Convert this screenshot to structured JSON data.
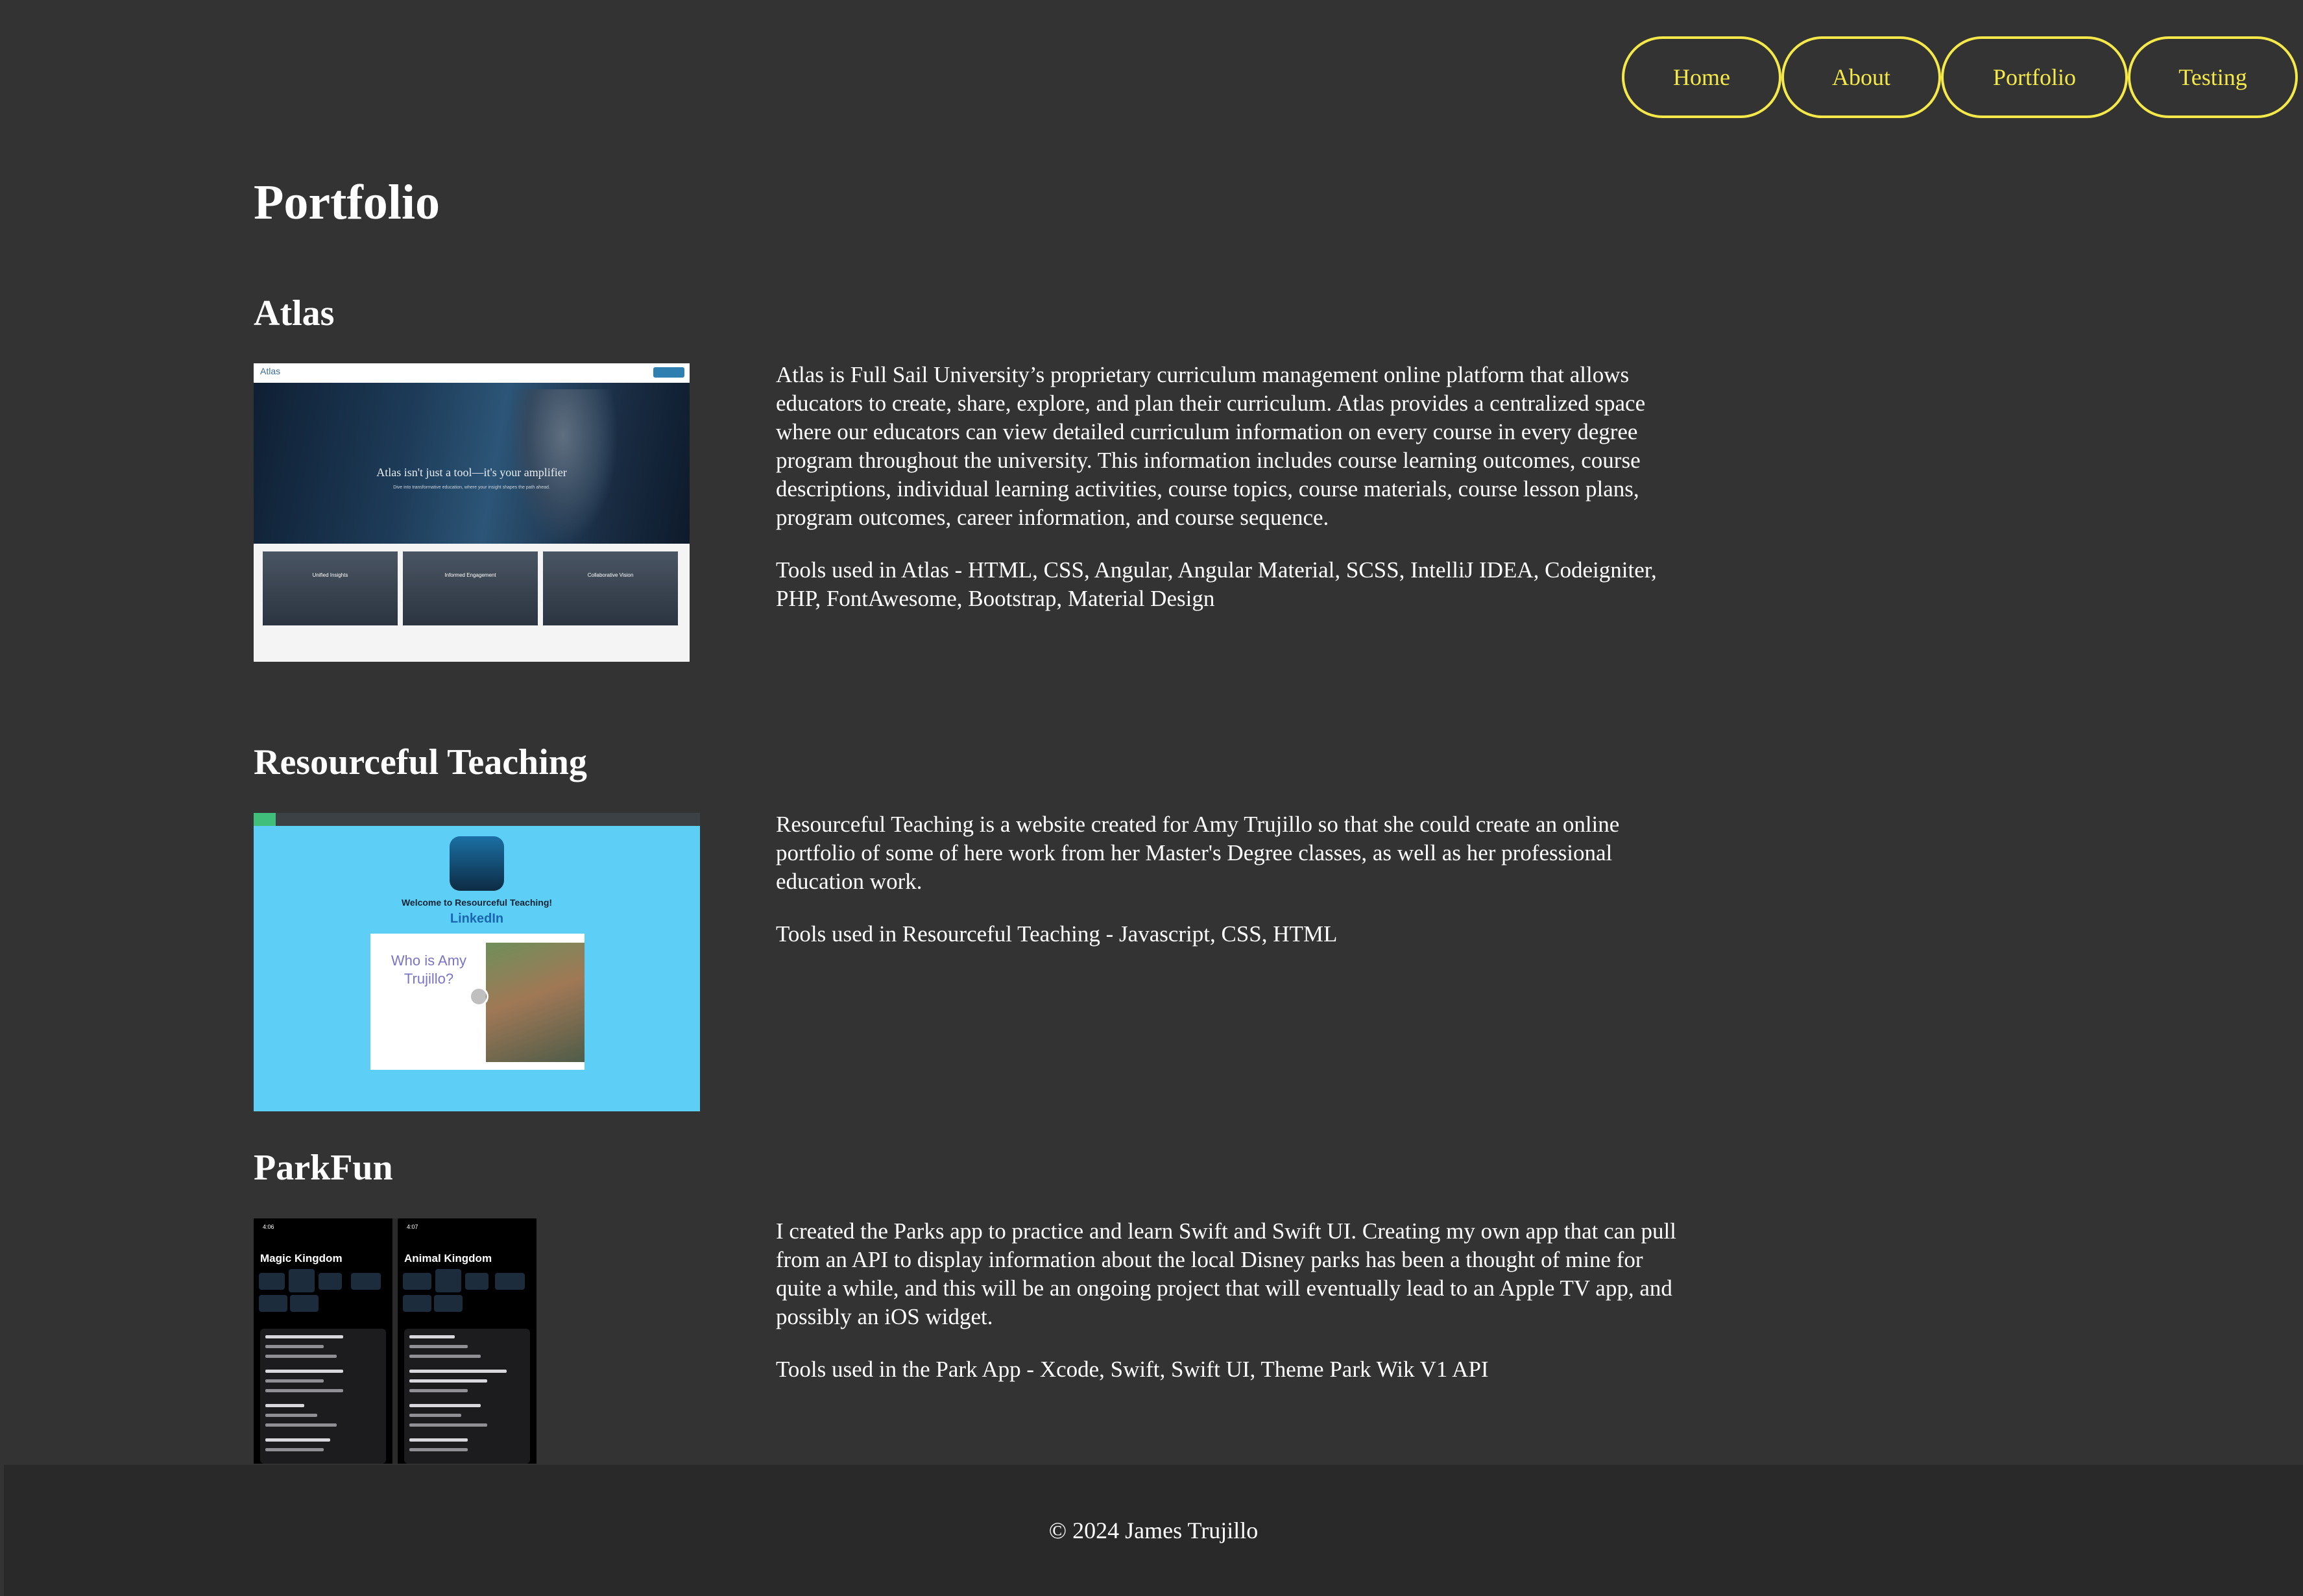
{
  "nav": {
    "items": [
      {
        "label": "Home"
      },
      {
        "label": "About"
      },
      {
        "label": "Portfolio"
      },
      {
        "label": "Testing"
      }
    ]
  },
  "page": {
    "title": "Portfolio"
  },
  "projects": [
    {
      "title": "Atlas",
      "description": "Atlas is Full Sail University’s proprietary curriculum management online platform that allows educators to create, share, explore, and plan their curriculum. Atlas provides a centralized space where our educators can view detailed curriculum information on every course in every degree program throughout the university. This information includes course learning outcomes, course descriptions, individual learning activities, course topics, course materials, course lesson plans, program outcomes, career information, and course sequence.",
      "tools": "Tools used in Atlas - HTML, CSS, Angular, Angular Material, SCSS, IntelliJ IDEA, Codeigniter, PHP, FontAwesome, Bootstrap, Material Design",
      "screenshot": {
        "logo": "Atlas",
        "hero_text": "Atlas isn't just a tool—it's your amplifier",
        "hero_sub": "Dive into transformative education, where your insight shapes the path ahead.",
        "cards": [
          "Unified Insights",
          "Informed Engagement",
          "Collaborative Vision"
        ]
      }
    },
    {
      "title": "Resourceful Teaching",
      "description": "Resourceful Teaching is a website created for Amy Trujillo so that she could create an online portfolio of some of here work from her Master's Degree classes, as well as her professional education work.",
      "tools": "Tools used in Resourceful Teaching - Javascript, CSS, HTML",
      "screenshot": {
        "welcome": "Welcome to Resourceful Teaching!",
        "linkedin": "LinkedIn",
        "who": "Who is Amy Trujillo?"
      }
    },
    {
      "title": "ParkFun",
      "description": "I created the Parks app to practice and learn Swift and Swift UI. Creating my own app that can pull from an API to display information about the local Disney parks has been a thought of mine for quite a while, and this will be an ongoing project that will eventually lead to an Apple TV app, and possibly an iOS widget.",
      "tools": "Tools used in the Park App - Xcode, Swift, Swift UI, Theme Park Wik V1 API",
      "screenshot": {
        "phones": [
          {
            "time": "4:06",
            "title": "Magic Kingdom"
          },
          {
            "time": "4:07",
            "title": "Animal Kingdom"
          }
        ]
      }
    }
  ],
  "footer": {
    "text": "© 2024 James Trujillo"
  },
  "colors": {
    "background": "#333333",
    "accent": "#f5e94a",
    "footer": "#292929",
    "text": "#ffffff"
  }
}
